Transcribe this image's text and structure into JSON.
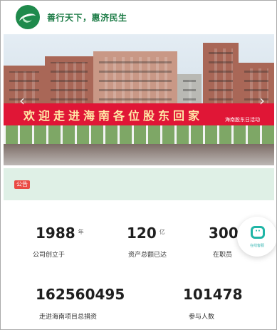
{
  "header": {
    "logo_icon": "company-logo",
    "slogan": "善行天下，惠济民生"
  },
  "banner": {
    "banner_text": "欢迎走进海南各位股东回家",
    "small_text": "海南股东日活动"
  },
  "notice": {
    "tag": "公告"
  },
  "stats": [
    {
      "value": "1988",
      "unit": "年",
      "label": "公司创立于"
    },
    {
      "value": "120",
      "unit": "亿",
      "label": "资产总额已达"
    },
    {
      "value": "300",
      "unit": "",
      "label": "在职员"
    },
    {
      "value": "162560495",
      "unit": "",
      "label": "走进海南项目总捐资"
    },
    {
      "value": "101478",
      "unit": "",
      "label": "参与人数"
    }
  ],
  "chat": {
    "icon": "chat-bubble-icon",
    "label": "在线客服"
  },
  "colors": {
    "brand_green": "#1f8a4c",
    "banner_red": "#e01636",
    "notice_bg": "#dff0e6",
    "notice_tag": "#ea4a44",
    "chat_teal": "#1fb5a6"
  }
}
